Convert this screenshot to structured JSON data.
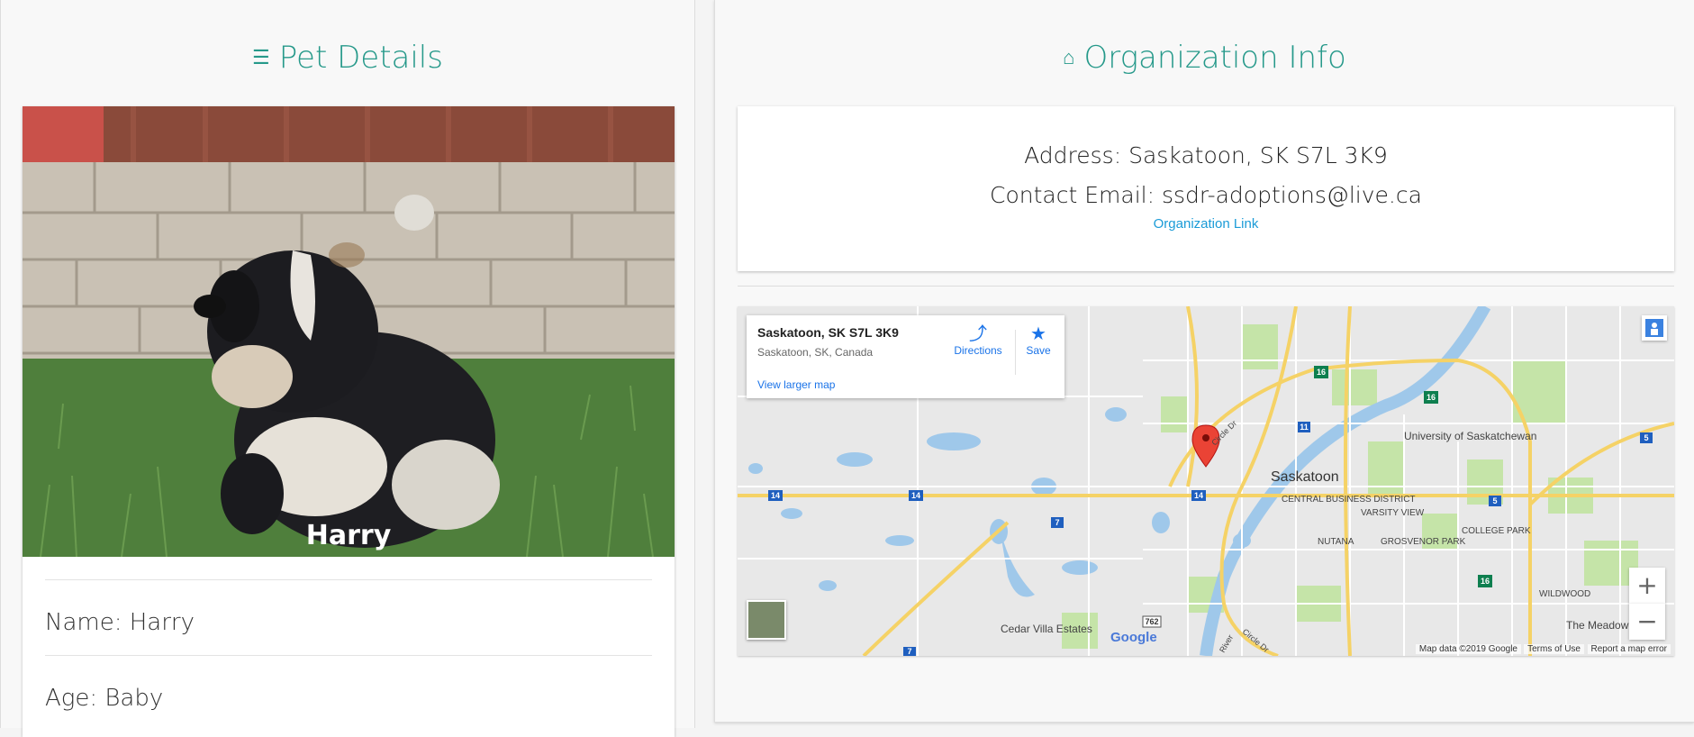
{
  "pet_panel": {
    "title": "Pet Details",
    "title_icon": "list-icon",
    "photo_caption": "Harry",
    "name_line": "Name: Harry",
    "age_line": "Age: Baby"
  },
  "org_panel": {
    "title": "Organization Info",
    "title_icon": "home-icon",
    "address_line": "Address: Saskatoon, SK S7L 3K9",
    "email_line": "Contact Email: ssdr-adoptions@live.ca",
    "link_label": "Organization Link"
  },
  "map": {
    "place_title": "Saskatoon, SK S7L 3K9",
    "place_sub": "Saskatoon, SK, Canada",
    "directions_label": "Directions",
    "save_label": "Save",
    "larger_map_label": "View larger map",
    "zoom_in": "+",
    "zoom_out": "−",
    "labels": {
      "city": "Saskatoon",
      "university": "University of Saskatchewan",
      "central": "CENTRAL BUSINESS DISTRICT",
      "varsity": "VARSITY VIEW",
      "college": "COLLEGE PARK",
      "nutana": "NUTANA",
      "grosvenor": "GROSVENOR PARK",
      "wildwood": "WILDWOOD",
      "meadows": "The Meadow",
      "cedar": "Cedar Villa Estates",
      "circle_dr": "Circle Dr",
      "circle_dr2": "Circle Dr",
      "river": "River"
    },
    "route_shields": [
      "14",
      "14",
      "14",
      "7",
      "11",
      "16",
      "16",
      "5",
      "5",
      "16",
      "762",
      "7"
    ],
    "google_logo": "Google",
    "footer_data": "Map data ©2019 Google",
    "footer_terms": "Terms of Use",
    "footer_report": "Report a map error",
    "colors": {
      "water": "#9fc8ea",
      "park": "#c5e4a8",
      "road": "#ffffff",
      "highway": "#f5d266",
      "land": "#e8e8e8",
      "pin": "#ea4335"
    }
  }
}
